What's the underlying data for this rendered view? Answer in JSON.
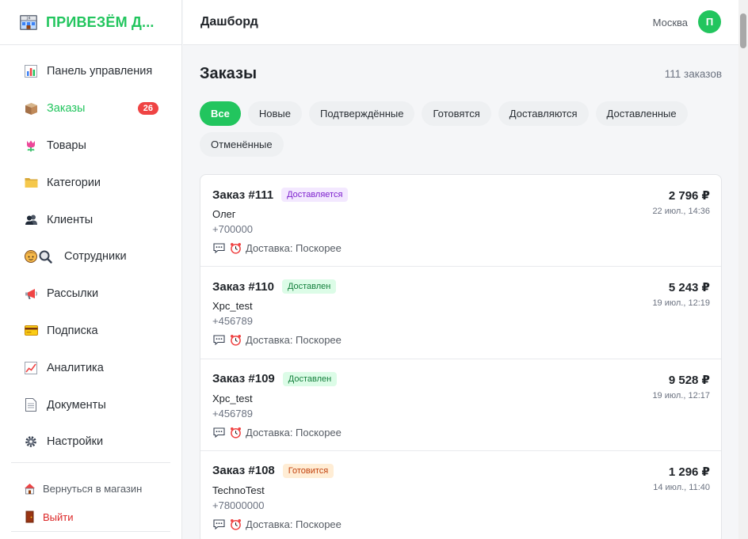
{
  "app": {
    "brand_name": "ПРИВЕЗЁМ Д...",
    "brand_icon": "shop-icon",
    "accent_color": "#22c55e"
  },
  "sidebar": {
    "items": [
      {
        "label": "Панель управления",
        "icon": "chart-icon"
      },
      {
        "label": "Заказы",
        "icon": "package-icon",
        "badge": "26",
        "active": true
      },
      {
        "label": "Товары",
        "icon": "tulip-icon"
      },
      {
        "label": "Категории",
        "icon": "folder-icon"
      },
      {
        "label": "Клиенты",
        "icon": "users-icon"
      },
      {
        "label": "Сотрудники",
        "icon": "staff-search-icon"
      },
      {
        "label": "Рассылки",
        "icon": "megaphone-icon"
      },
      {
        "label": "Подписка",
        "icon": "credit-card-icon"
      },
      {
        "label": "Аналитика",
        "icon": "trend-chart-icon"
      },
      {
        "label": "Документы",
        "icon": "document-icon"
      },
      {
        "label": "Настройки",
        "icon": "gear-icon"
      }
    ],
    "footer": {
      "back_label": "Вернуться в магазин",
      "exit_label": "Выйти"
    }
  },
  "header": {
    "title": "Дашборд",
    "city": "Москва",
    "avatar_letter": "П"
  },
  "main": {
    "title": "Заказы",
    "count": "111 заказов",
    "filters": [
      {
        "label": "Все",
        "active": true
      },
      {
        "label": "Новые"
      },
      {
        "label": "Подтверждённые"
      },
      {
        "label": "Готовятся"
      },
      {
        "label": "Доставляются"
      },
      {
        "label": "Доставленные"
      },
      {
        "label": "Отменённые"
      }
    ],
    "orders": [
      {
        "title": "Заказ #111",
        "status": "Доставляется",
        "status_color": "#7e22ce",
        "customer": "Олег",
        "phone": "+700000",
        "delivery": "Доставка: Поскорее",
        "price": "2 796 ₽",
        "date": "22 июл., 14:36"
      },
      {
        "title": "Заказ #110",
        "status": "Доставлен",
        "status_color": "#15803d",
        "customer": "Xpc_test",
        "phone": "+456789",
        "delivery": "Доставка: Поскорее",
        "price": "5 243 ₽",
        "date": "19 июл., 12:19"
      },
      {
        "title": "Заказ #109",
        "status": "Доставлен",
        "status_color": "#15803d",
        "customer": "Xpc_test",
        "phone": "+456789",
        "delivery": "Доставка: Поскорее",
        "price": "9 528 ₽",
        "date": "19 июл., 12:17"
      },
      {
        "title": "Заказ #108",
        "status": "Готовится",
        "status_color": "#c2410c",
        "customer": "TechnoTest",
        "phone": "+78000000",
        "delivery": "Доставка: Поскорее",
        "price": "1 296 ₽",
        "date": "14 июл., 11:40"
      }
    ]
  }
}
